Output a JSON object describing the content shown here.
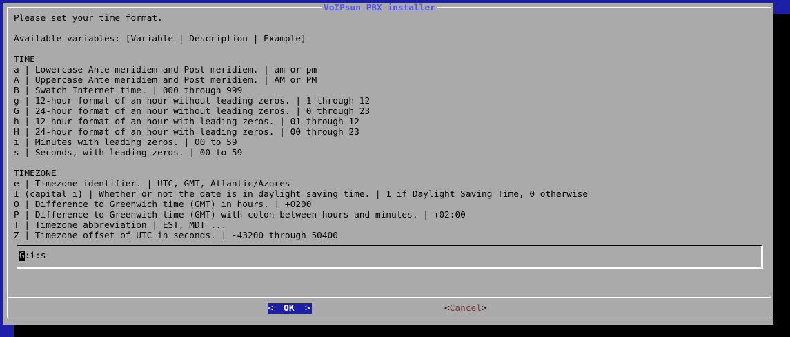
{
  "window": {
    "title": "VoIPsun PBX installer"
  },
  "dialog": {
    "lines": [
      "Please set your time format.",
      "",
      "Available variables: [Variable | Description | Example]",
      "",
      "TIME",
      "a | Lowercase Ante meridiem and Post meridiem. | am or pm",
      "A | Uppercase Ante meridiem and Post meridiem. | AM or PM",
      "B | Swatch Internet time. | 000 through 999",
      "g | 12-hour format of an hour without leading zeros. | 1 through 12",
      "G | 24-hour format of an hour without leading zeros. | 0 through 23",
      "h | 12-hour format of an hour with leading zeros. | 01 through 12",
      "H | 24-hour format of an hour with leading zeros. | 00 through 23",
      "i | Minutes with leading zeros. | 00 to 59",
      "s | Seconds, with leading zeros. | 00 to 59",
      "",
      "TIMEZONE",
      "e | Timezone identifier. | UTC, GMT, Atlantic/Azores",
      "I (capital i) | Whether or not the date is in daylight saving time. | 1 if Daylight Saving Time, 0 otherwise",
      "O | Difference to Greenwich time (GMT) in hours. | +0200",
      "P | Difference to Greenwich time (GMT) with colon between hours and minutes. | +02:00",
      "T | Timezone abbreviation | EST, MDT ...",
      "Z | Timezone offset of UTC in seconds. | -43200 through 50400"
    ]
  },
  "input": {
    "cursor_char": "G",
    "rest": ":i:s"
  },
  "buttons": {
    "ok_left": "<  ",
    "ok_label": "OK",
    "ok_right": "  >",
    "cancel_left": "<",
    "cancel_label": "Cancel",
    "cancel_right": ">"
  },
  "colors": {
    "background": "#1d1fa8",
    "dialog": "#aaaaaa",
    "title": "#5557f5",
    "selected_button": "#1d1fa8",
    "cancel_hotkey": "#8a3a3a"
  }
}
